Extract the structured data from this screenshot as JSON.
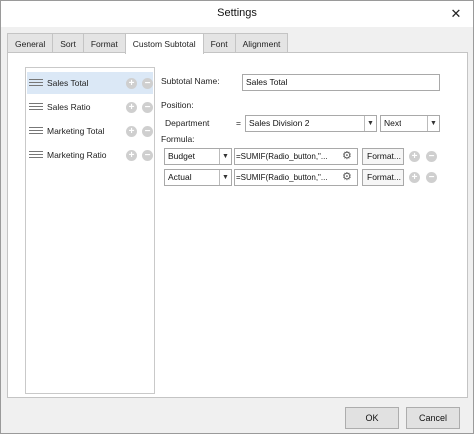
{
  "window": {
    "title": "Settings",
    "close_glyph": "✕"
  },
  "tabs": [
    {
      "label": "General"
    },
    {
      "label": "Sort"
    },
    {
      "label": "Format"
    },
    {
      "label": "Custom Subtotal",
      "active": true
    },
    {
      "label": "Font"
    },
    {
      "label": "Alignment"
    }
  ],
  "list": {
    "items": [
      {
        "label": "Sales Total",
        "selected": true
      },
      {
        "label": "Sales Ratio"
      },
      {
        "label": "Marketing Total"
      },
      {
        "label": "Marketing Ratio"
      }
    ],
    "add_glyph": "+",
    "remove_glyph": "−"
  },
  "form": {
    "subtotal_name_label": "Subtotal Name:",
    "subtotal_name_value": "Sales Total",
    "position_label": "Position:",
    "department_label": "Department",
    "equals": "=",
    "position_value": "Sales Division 2",
    "position_relation": "Next",
    "formula_label": "Formula:",
    "formulas": [
      {
        "field": "Budget",
        "equals": "=",
        "expression": "=SUMIF(Radio_button,\"...",
        "format_label": "Format..."
      },
      {
        "field": "Actual",
        "equals": "=",
        "expression": "=SUMIF(Radio_button,\"...",
        "format_label": "Format..."
      }
    ]
  },
  "footer": {
    "ok_label": "OK",
    "cancel_label": "Cancel"
  },
  "colors": {
    "selected_row": "#dbe8f6",
    "window_bg": "#f0f0f0"
  }
}
